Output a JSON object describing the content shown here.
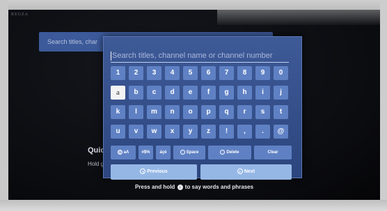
{
  "brand": "REGZA",
  "background": {
    "search_text": "Search titles, char",
    "quick_title": "Quic",
    "hold_text": "Hold get to"
  },
  "hint": {
    "before": "Press and hold",
    "mic_glyph": "↓",
    "after": "to say words and phrases"
  },
  "keyboard": {
    "input_placeholder": "Search titles, channel name or channel number",
    "rows": [
      [
        "1",
        "2",
        "3",
        "4",
        "5",
        "6",
        "7",
        "8",
        "9",
        "0"
      ],
      [
        "a",
        "b",
        "c",
        "d",
        "e",
        "f",
        "g",
        "h",
        "i",
        "j"
      ],
      [
        "k",
        "l",
        "m",
        "n",
        "o",
        "p",
        "q",
        "r",
        "s",
        "t"
      ],
      [
        "u",
        "v",
        "w",
        "x",
        "y",
        "z",
        "!",
        ",",
        ".",
        "@"
      ]
    ],
    "selected_key": "a",
    "function_keys": {
      "case": "aA",
      "symbols": "#$%",
      "accents": "áçé",
      "space": "Space",
      "delete": "Delete",
      "clear": "Clear"
    },
    "nav": {
      "previous": "Previous",
      "next": "Next"
    }
  },
  "colors": {
    "panel": "#3e5a97",
    "key": "#5f81c4",
    "key_selected": "#f3f3f3",
    "nav_button": "#95b7e6"
  }
}
